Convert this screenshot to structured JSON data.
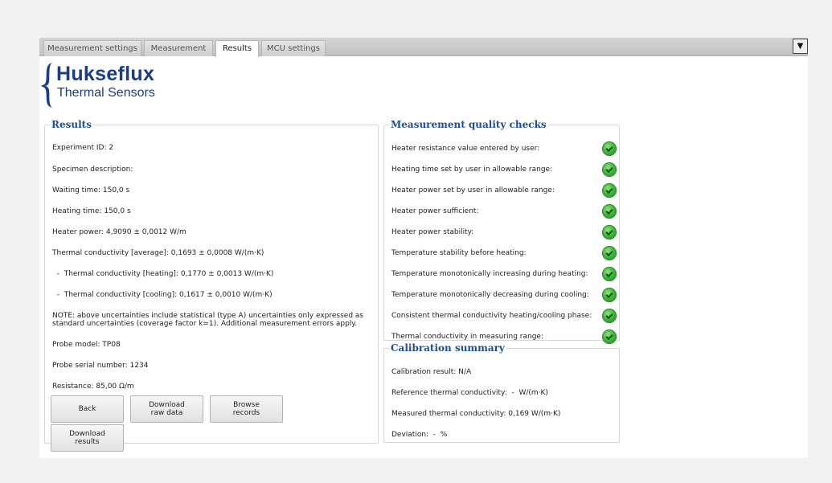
{
  "tabs": [
    "Measurement settings",
    "Measurement",
    "Results",
    "MCU settings"
  ],
  "dropdown_glyph": "▼",
  "logo": {
    "name": "Hukseflux",
    "subtitle": "Thermal Sensors"
  },
  "results": {
    "legend": "Results",
    "experiment_id": "Experiment ID: 2",
    "specimen": "Specimen description:",
    "waiting_time": "Waiting time:  150,0 s",
    "heating_time": "Heating time:  150,0 s",
    "heater_power": "Heater power: 4,9090  ± 0,0012 W/m",
    "tc_average": "Thermal conductivity [average]: 0,1693 ± 0,0008 W/(m·K)",
    "tc_heating": "  -  Thermal conductivity [heating]: 0,1770 ± 0,0013 W/(m·K)",
    "tc_cooling": "  -  Thermal conductivity [cooling]: 0,1617 ± 0,0010 W/(m·K)",
    "note_line1": "NOTE: above uncertainties include statistical (type A) uncertainties only expressed as",
    "note_line2": "standard uncertainties (coverage factor k=1). Additional measurement errors apply.",
    "probe_model": "Probe model: TP08",
    "probe_serial": "Probe serial number: 1234",
    "resistance": "Resistance: 85,00 Ω/m",
    "buttons": {
      "back": "Back",
      "download_raw": "Download\nraw data",
      "browse": "Browse\nrecords",
      "download_results": "Download\nresults"
    }
  },
  "quality": {
    "legend": "Measurement quality checks",
    "checks": [
      "Heater resistance value entered by user:",
      "Heating time set by user in allowable range:",
      "Heater power set by user in allowable range:",
      "Heater power sufficient:",
      "Heater power stability:",
      "Temperature stability before heating:",
      "Temperature monotonically increasing during heating:",
      "Temperature monotonically decreasing during cooling:",
      "Consistent thermal conductivity heating/cooling phase:",
      "Thermal conductivity in measuring range:"
    ],
    "status_color": "#3fb53a"
  },
  "calibration": {
    "legend": "Calibration summary",
    "result": "Calibration result: N/A",
    "reference": "Reference thermal conductivity:  -  W/(m·K)",
    "measured": "Measured thermal conductivity: 0,169 W/(m·K)",
    "deviation": "Deviation:  -  %"
  },
  "colors": {
    "brand": "#1a3c8c",
    "legend": "#1f4e98"
  }
}
